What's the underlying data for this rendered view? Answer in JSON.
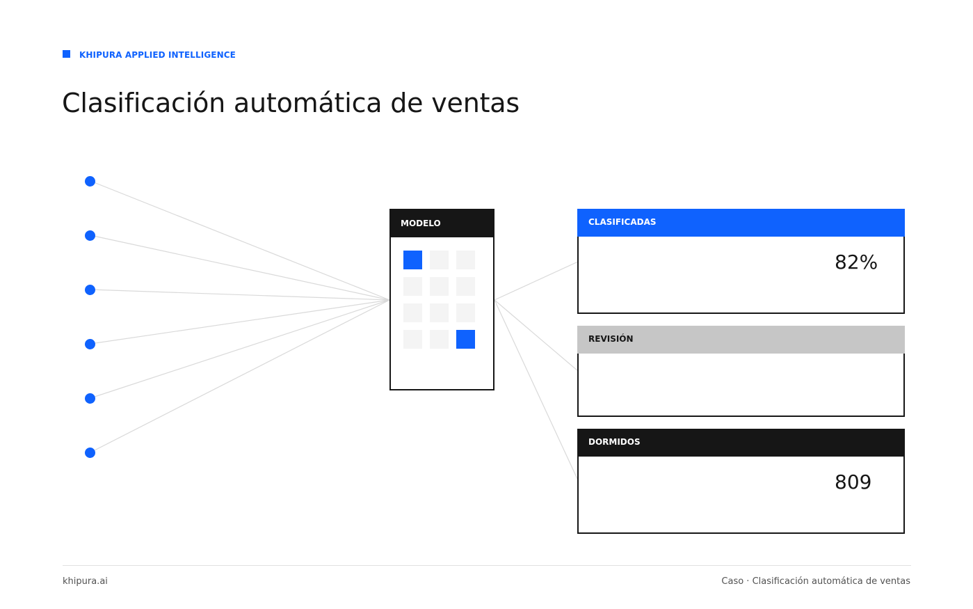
{
  "brand": {
    "name": "KHIPURA APPLIED INTELLIGENCE",
    "accent": "#0f62fe"
  },
  "title": "Clasificación automática de ventas",
  "diagram": {
    "input_count": 6,
    "model": {
      "label": "MODELO",
      "grid": [
        [
          true,
          false,
          false
        ],
        [
          false,
          false,
          false
        ],
        [
          false,
          false,
          false
        ],
        [
          false,
          false,
          true
        ]
      ]
    },
    "outputs": [
      {
        "label": "CLASIFICADAS",
        "value": "82%",
        "header_color": "#0f62fe"
      },
      {
        "label": "REVISIÓN",
        "value": "",
        "header_color": "#c6c6c6"
      },
      {
        "label": "DORMIDOS",
        "value": "809",
        "header_color": "#161616"
      }
    ]
  },
  "footer": {
    "left": "khipura.ai",
    "right": "Caso · Clasificación automática de ventas"
  }
}
